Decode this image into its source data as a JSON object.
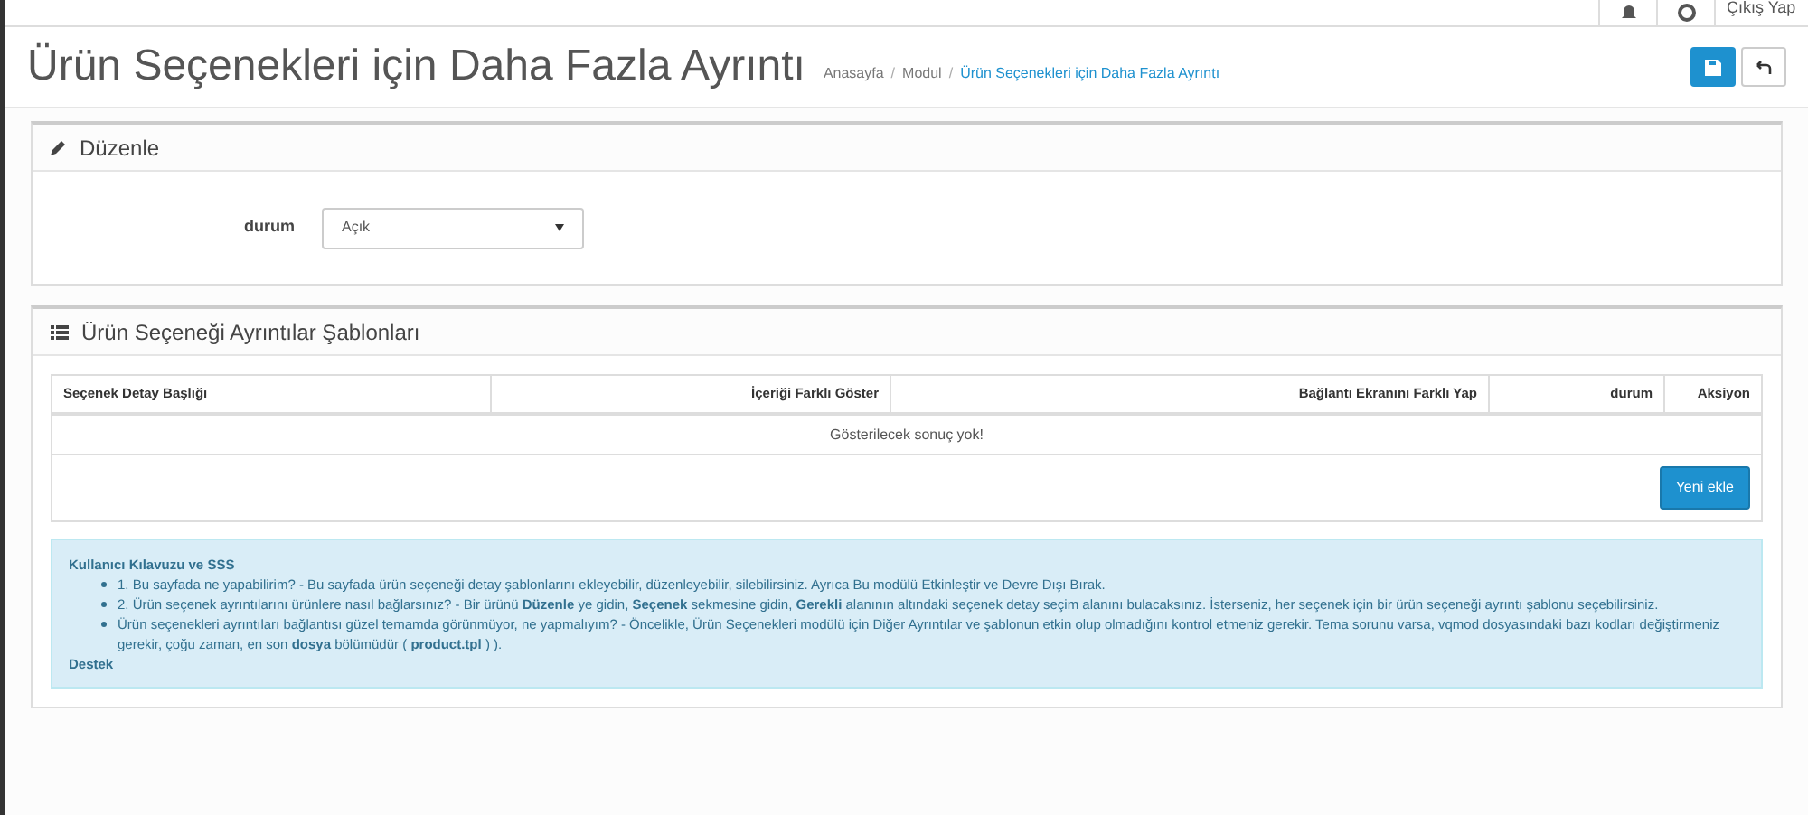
{
  "topbar": {
    "logout": "Çıkış Yap"
  },
  "header": {
    "title": "Ürün Seçenekleri için Daha Fazla Ayrıntı",
    "breadcrumb": [
      "Anasayfa",
      "Modul",
      "Ürün Seçenekleri için Daha Fazla Ayrıntı"
    ],
    "breadcrumb_separator": "/"
  },
  "edit_panel": {
    "title": "Düzenle",
    "field_label": "durum",
    "field_value": "Açık"
  },
  "templates_panel": {
    "title": "Ürün Seçeneği Ayrıntılar Şablonları",
    "columns": [
      "Seçenek Detay Başlığı",
      "İçeriği Farklı Göster",
      "Bağlantı Ekranını Farklı Yap",
      "durum",
      "Aksiyon"
    ],
    "empty_message": "Gösterilecek sonuç yok!",
    "add_button": "Yeni ekle"
  },
  "help": {
    "title": "Kullanıcı Kılavuzu ve SSS",
    "items": [
      "1. Bu sayfada ne yapabilirim? - Bu sayfada ürün seçeneği detay şablonlarını ekleyebilir, düzenleyebilir, silebilirsiniz. Ayrıca Bu modülü Etkinleştir ve Devre Dışı Bırak.",
      "2. Ürün seçenek ayrıntılarını ürünlere nasıl bağlarsınız? - Bir ürünü **Düzenle** ye gidin, **Seçenek** sekmesine gidin, **Gerekli** alanının altındaki seçenek detay seçim alanını bulacaksınız. İsterseniz, her seçenek için bir ürün seçeneği ayrıntı şablonu seçebilirsiniz.",
      "Ürün seçenekleri ayrıntıları bağlantısı güzel temamda görünmüyor, ne yapmalıyım? - Öncelikle, Ürün Seçenekleri modülü için Diğer Ayrıntılar ve şablonun etkin olup olmadığını kontrol etmeniz gerekir. Tema sorunu varsa, vqmod dosyasındaki bazı kodları değiştirmeniz gerekir, çoğu zaman, en son **dosya** bölümüdür ( **product.tpl** ) )."
    ],
    "footer": "Destek"
  }
}
